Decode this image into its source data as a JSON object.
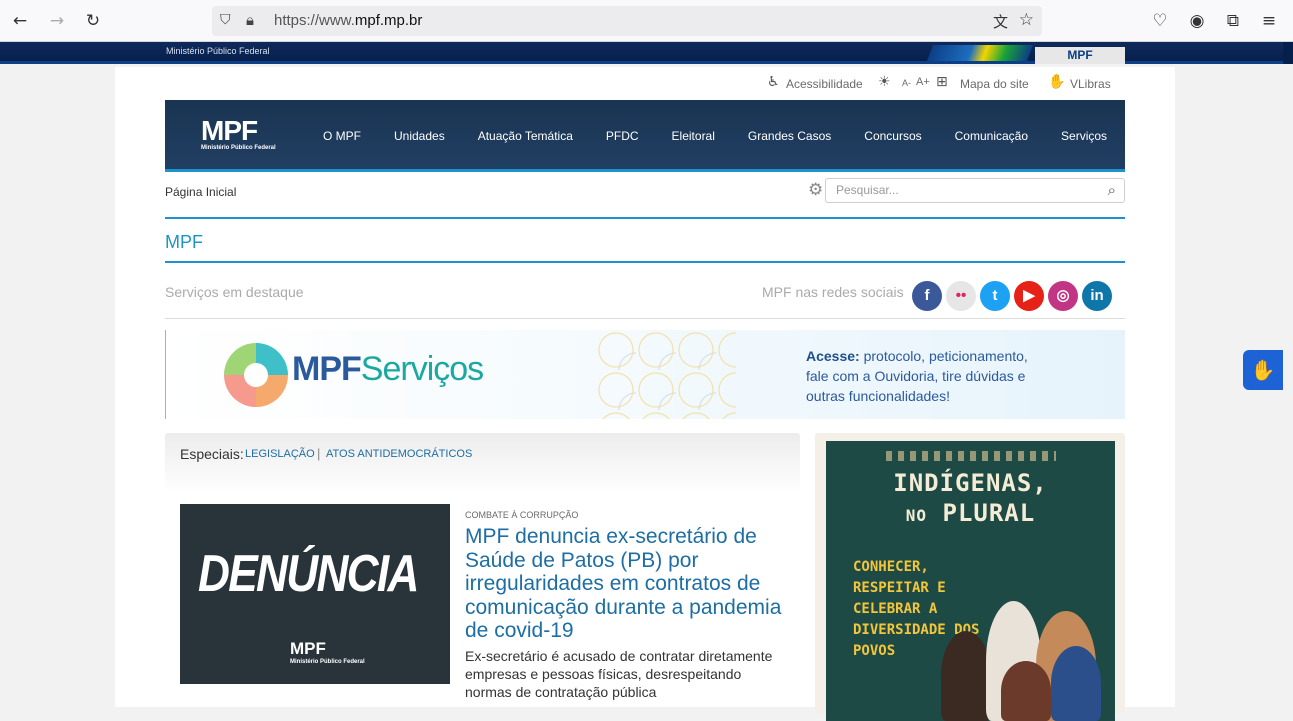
{
  "browser": {
    "url_prefix": "https://www.",
    "url_domain": "mpf.mp.br",
    "back_icon": "arrow-left-icon",
    "forward_icon": "arrow-right-icon",
    "reload_icon": "reload-icon"
  },
  "gov_bar": {
    "label": "Ministério Público Federal",
    "tab": "MPF"
  },
  "accessibility_bar": {
    "accessibility": "Acessibilidade",
    "font_minus": "A-",
    "font_plus": "A+",
    "sitemap": "Mapa do site",
    "vlibras": "VLibras"
  },
  "header": {
    "logo_big": "MPF",
    "logo_small": "Ministério Público Federal",
    "menu": [
      "O MPF",
      "Unidades",
      "Atuação Temática",
      "PFDC",
      "Eleitoral",
      "Grandes Casos",
      "Concursos",
      "Comunicação",
      "Serviços"
    ]
  },
  "breadcrumb": "Página Inicial",
  "search": {
    "placeholder": "Pesquisar..."
  },
  "section_title": "MPF",
  "services_label": "Serviços em destaque",
  "social_label": "MPF nas redes sociais",
  "social": [
    {
      "name": "facebook",
      "glyph": "f",
      "color": "#3b5998"
    },
    {
      "name": "flickr",
      "glyph": "••",
      "color": "#e6e6e6"
    },
    {
      "name": "twitter",
      "glyph": "t",
      "color": "#1da1f2"
    },
    {
      "name": "youtube",
      "glyph": "▶",
      "color": "#e62117"
    },
    {
      "name": "instagram",
      "glyph": "◎",
      "color": "#c13584"
    },
    {
      "name": "linkedin",
      "glyph": "in",
      "color": "#0e76a8"
    }
  ],
  "banner": {
    "title_bold": "MPF",
    "title_rest": "Serviços",
    "text_bold": "Acesse:",
    "text_rest": " protocolo, peticionamento, fale com a Ouvidoria, tire dúvidas e outras funcionalidades!"
  },
  "especiais": {
    "label": "Especiais:",
    "links": [
      "LEGISLAÇÃO",
      "ATOS ANTIDEMOCRÁTICOS"
    ],
    "separator": "|"
  },
  "news": {
    "image_title": "DENÚNCIA",
    "image_logo": "MPF",
    "image_logo_small": "Ministério Público Federal",
    "kicker": "COMBATE À CORRUPÇÃO",
    "headline": "MPF denuncia ex-secretário de Saúde de Patos (PB) por irregularidades em contratos de comunicação durante a pandemia de covid-19",
    "summary": "Ex-secretário é acusado de contratar diretamente empresas e pessoas físicas, desrespeitando normas de contratação pública"
  },
  "poster": {
    "line1": "INDÍGENAS,",
    "line2_small": "NO",
    "line2_big": "PLURAL",
    "subtitle": "CONHECER, RESPEITAR E CELEBRAR A DIVERSIDADE DOS POVOS"
  }
}
